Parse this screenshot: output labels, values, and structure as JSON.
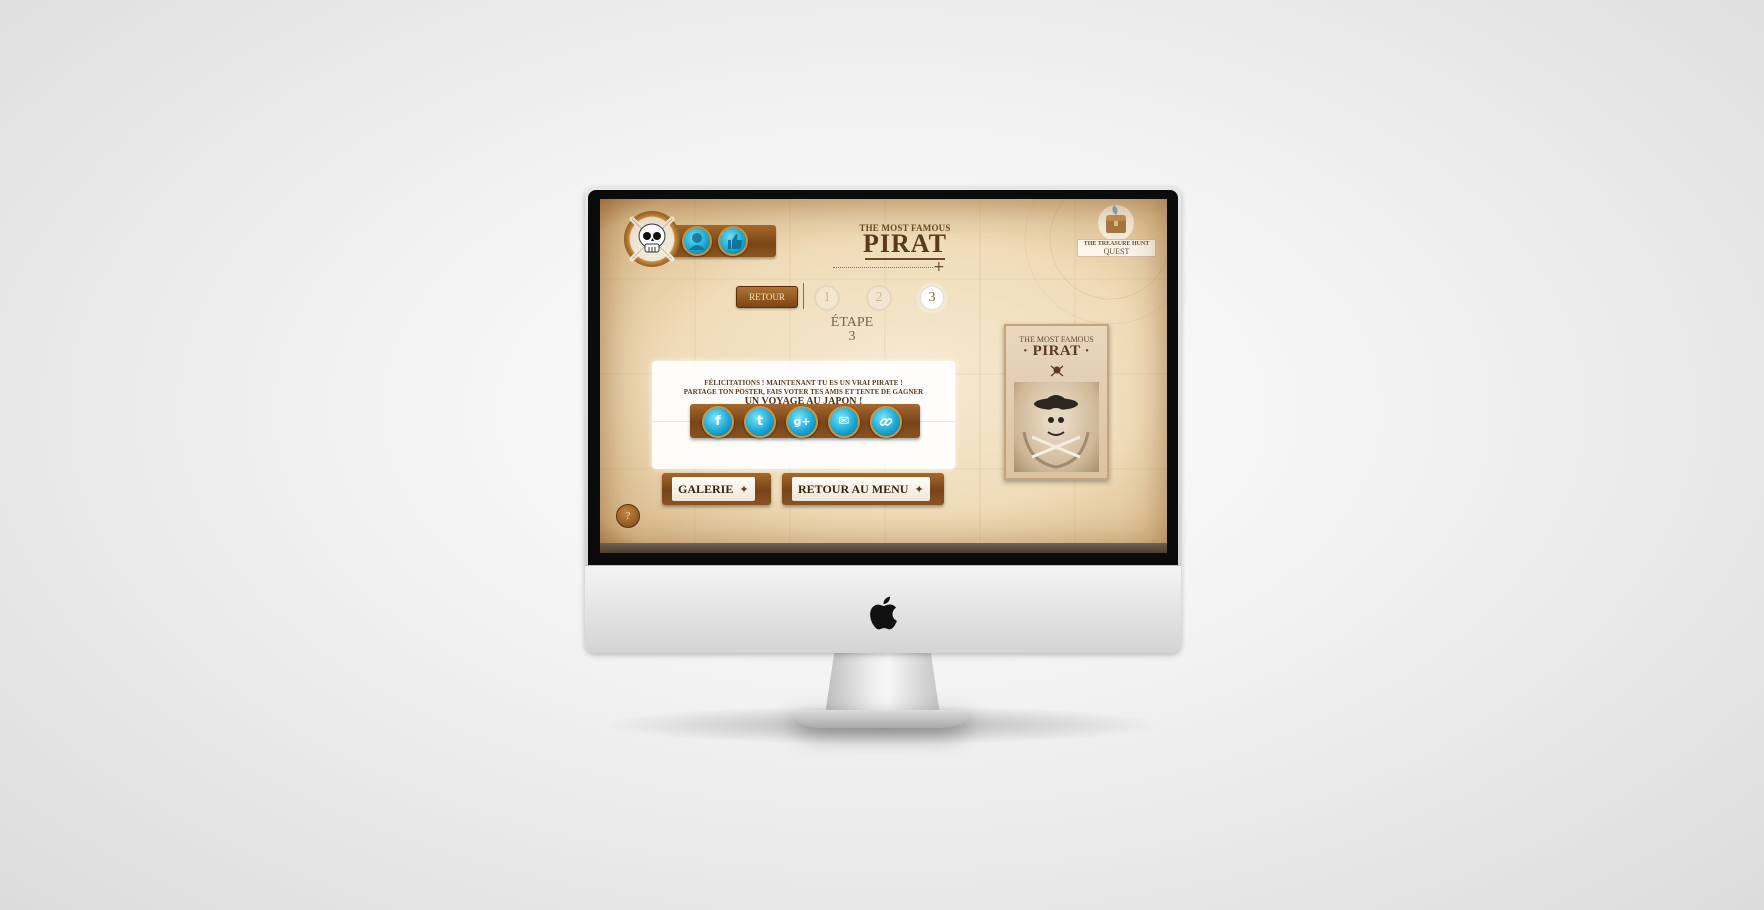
{
  "header": {
    "title_small": "THE MOST FAMOUS",
    "title_big": "PIRAT",
    "quest_logo": {
      "top": "THE TREASURE HUNT",
      "bottom": "QUEST"
    },
    "icons": [
      "skull-crossbones-icon",
      "profile-icon",
      "like-icon"
    ]
  },
  "nav": {
    "retour_label": "RETOUR",
    "steps": [
      "1",
      "2",
      "3"
    ],
    "active_step": "3"
  },
  "etape": {
    "label": "ÉTAPE",
    "number": "3"
  },
  "message": {
    "line1": "FÉLICITATIONS ! MAINTENANT TU ES UN VRAI PIRATE !",
    "line2": "PARTAGE TON POSTER, FAIS VOTER TES AMIS ET TENTE DE GAGNER",
    "line3": "UN VOYAGE AU JAPON !"
  },
  "share": {
    "facebook": "f",
    "twitter": "t",
    "google_plus": "g+",
    "email": "✉",
    "link": "🔗"
  },
  "buttons": {
    "galerie": "GALERIE",
    "retour_menu": "RETOUR AU MENU"
  },
  "poster": {
    "title_small": "THE MOST FAMOUS",
    "title_big": "· PIRAT ·"
  },
  "help": "?",
  "colors": {
    "wood": "#8a521f",
    "parchment": "#efdcb8",
    "accent_blue": "#1aa8d3",
    "text_brown": "#5b3b1d"
  }
}
